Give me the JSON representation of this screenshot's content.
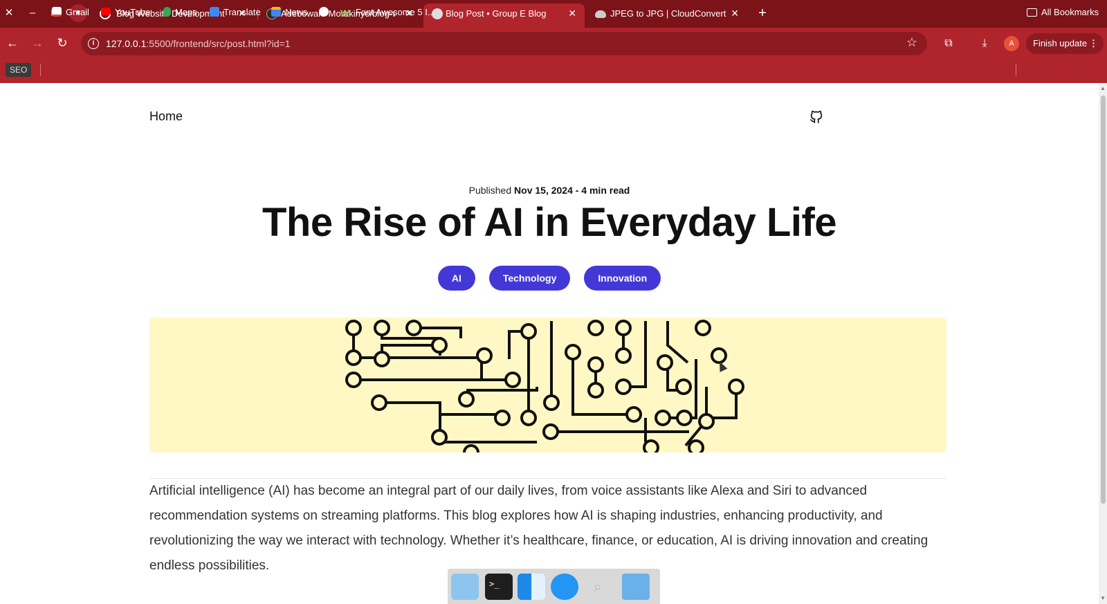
{
  "browser": {
    "tabs": [
      {
        "title": "Blog Website Development Pl",
        "active": false,
        "favicon": "chatgpt-icon"
      },
      {
        "title": "Adebowale-Morakinyo/blog-w",
        "active": false,
        "favicon": "github-icon"
      },
      {
        "title": "Blog Post • Group E Blog",
        "active": true,
        "favicon": "globe-icon"
      },
      {
        "title": "JPEG to JPG | CloudConvert",
        "active": false,
        "favicon": "cloud-icon"
      }
    ],
    "url_host": "127.0.0.1",
    "url_path": ":5500/frontend/src/post.html?id=1",
    "finish_update": "Finish update",
    "avatar_letter": "A",
    "bookmarks": {
      "seo": "SEO",
      "items": [
        "Gmail",
        "YouTube",
        "Maps",
        "Translate",
        "News",
        "",
        "Font Awesome 5 I..."
      ],
      "all": "All Bookmarks"
    },
    "theme_color": "#b0242c"
  },
  "page": {
    "home": "Home",
    "meta_prefix": "Published ",
    "meta_date": "Nov 15, 2024 - 4 min read",
    "title": "The Rise of AI in Everyday Life",
    "tags": [
      "AI",
      "Technology",
      "Innovation"
    ],
    "tag_color": "#4338d6",
    "hero_bg": "#fff8c4",
    "body": "Artificial intelligence (AI) has become an integral part of our daily lives, from voice assistants like Alexa and Siri to advanced recommendation systems on streaming platforms. This blog explores how AI is shaping industries, enhancing productivity, and revolutionizing the way we interact with technology. Whether it’s healthcare, finance, or education, AI is driving innovation and creating endless possibilities."
  }
}
